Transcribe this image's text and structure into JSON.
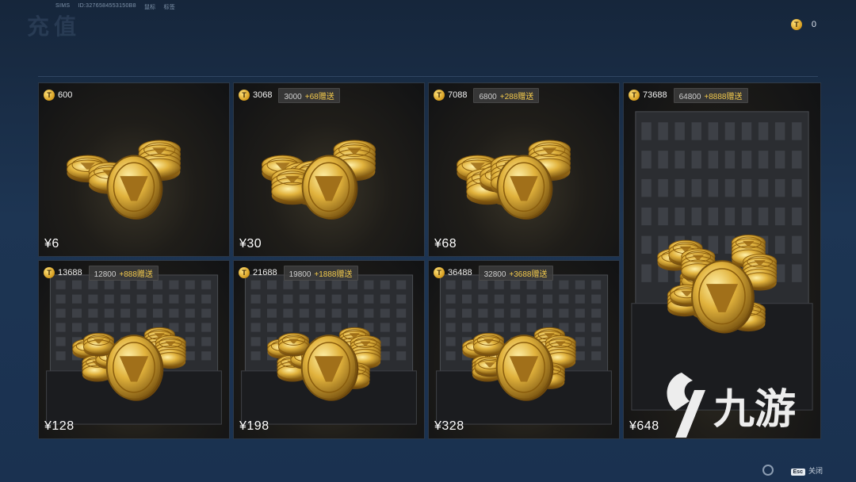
{
  "header": {
    "server": "SIMS",
    "player_id": "ID:3276584553150B8",
    "extra_1": "鼠标",
    "extra_2": "标签",
    "ghost_title": "充值"
  },
  "balance": {
    "icon": "coin-icon",
    "value": "0"
  },
  "packs": [
    {
      "amount": "600",
      "base": "",
      "bonus": "",
      "price": "¥6"
    },
    {
      "amount": "3068",
      "base": "3000",
      "bonus": "+68赠送",
      "price": "¥30"
    },
    {
      "amount": "7088",
      "base": "6800",
      "bonus": "+288赠送",
      "price": "¥68"
    },
    {
      "amount": "73688",
      "base": "64800",
      "bonus": "+8888赠送",
      "price": "¥648"
    },
    {
      "amount": "13688",
      "base": "12800",
      "bonus": "+888赠送",
      "price": "¥128"
    },
    {
      "amount": "21688",
      "base": "19800",
      "bonus": "+1888赠送",
      "price": "¥198"
    },
    {
      "amount": "36488",
      "base": "32800",
      "bonus": "+3688赠送",
      "price": "¥328"
    }
  ],
  "footer": {
    "esc_key": "Esc",
    "close_label": "关闭"
  },
  "watermark": {
    "text": "九游"
  },
  "colors": {
    "gold": "#f2c94c",
    "background": "#1d3553"
  }
}
